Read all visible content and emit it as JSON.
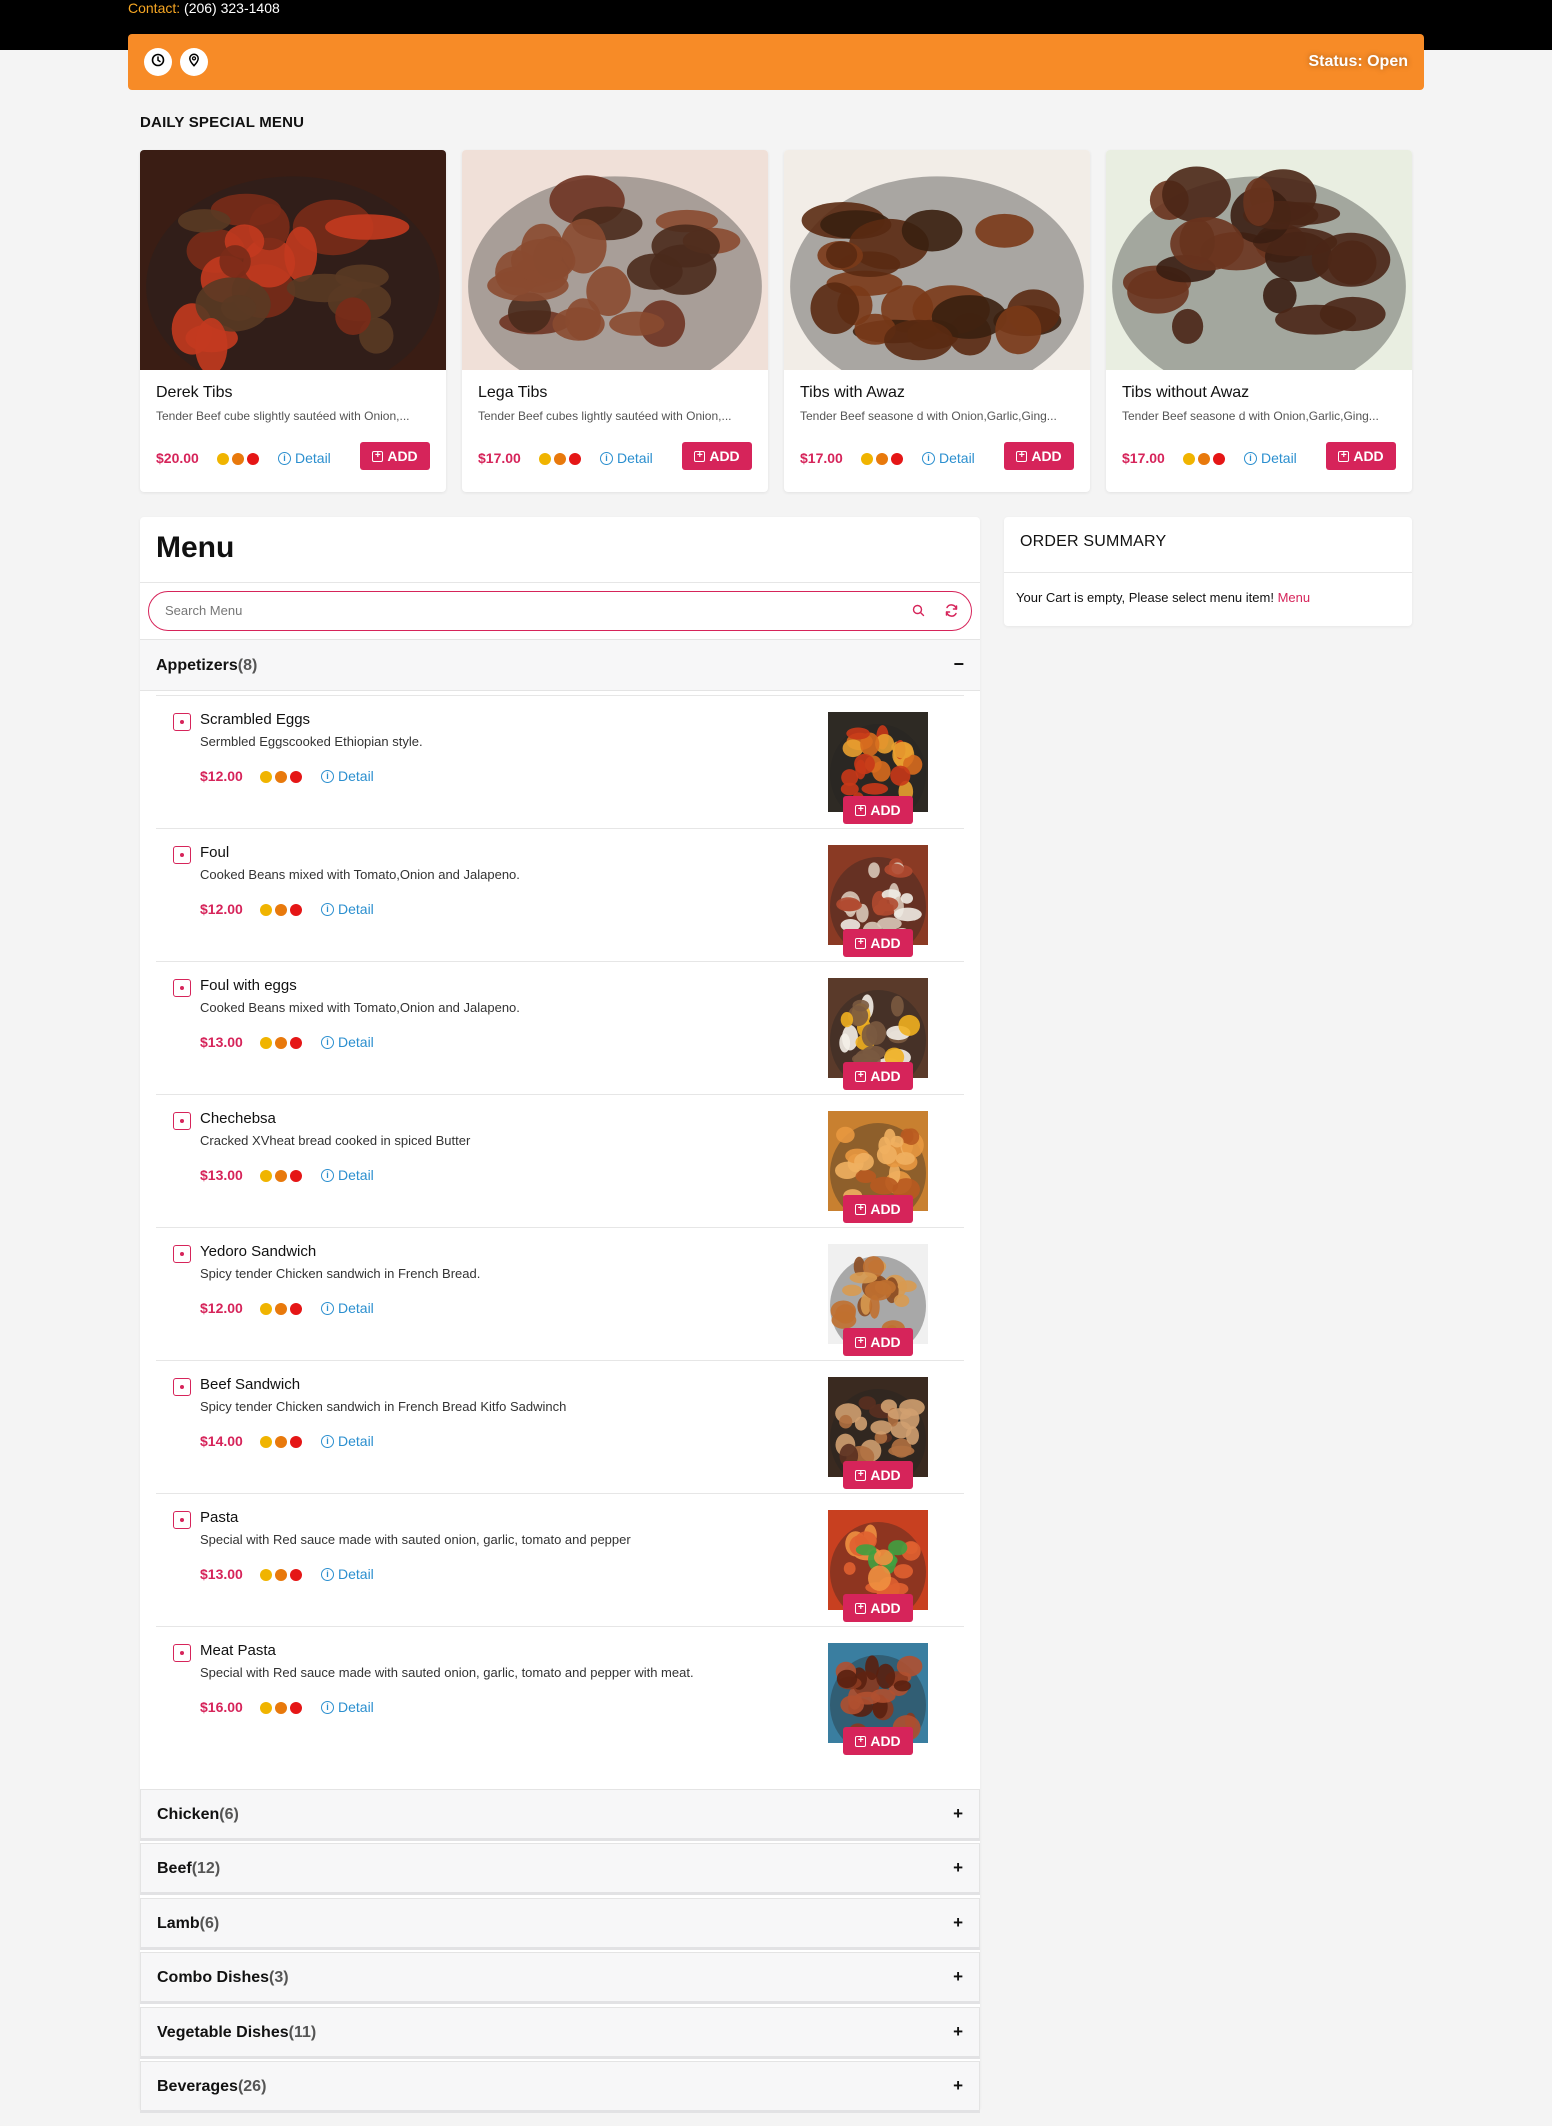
{
  "header": {
    "contact_label": "Contact:",
    "contact_phone": "(206) 323-1408",
    "status": "Status: Open",
    "clock_icon": "clock-icon",
    "location_icon": "map-pin-icon"
  },
  "specials": {
    "title": "DAILY SPECIAL MENU",
    "items": [
      {
        "name": "Derek Tibs",
        "desc": "Tender Beef cube slightly sautéed with Onion,...",
        "price": "$20.00",
        "detail": "Detail",
        "add": "ADD"
      },
      {
        "name": "Lega Tibs",
        "desc": "Tender Beef cubes lightly sautéed with Onion,...",
        "price": "$17.00",
        "detail": "Detail",
        "add": "ADD"
      },
      {
        "name": "Tibs with Awaz",
        "desc": "Tender Beef seasone d with Onion,Garlic,Ging...",
        "price": "$17.00",
        "detail": "Detail",
        "add": "ADD"
      },
      {
        "name": "Tibs without Awaz",
        "desc": "Tender Beef seasone d with Onion,Garlic,Ging...",
        "price": "$17.00",
        "detail": "Detail",
        "add": "ADD"
      }
    ]
  },
  "menu": {
    "title": "Menu",
    "search_placeholder": "Search Menu",
    "open_category": {
      "name": "Appetizers",
      "count": "(8)",
      "toggle": "−"
    },
    "items": [
      {
        "name": "Scrambled Eggs",
        "desc": "Sermbled Eggscooked Ethiopian style.",
        "price": "$12.00",
        "detail": "Detail",
        "add": "ADD"
      },
      {
        "name": "Foul",
        "desc": "Cooked Beans mixed with Tomato,Onion and Jalapeno.",
        "price": "$12.00",
        "detail": "Detail",
        "add": "ADD"
      },
      {
        "name": "Foul with eggs",
        "desc": "Cooked Beans mixed with Tomato,Onion and Jalapeno.",
        "price": "$13.00",
        "detail": "Detail",
        "add": "ADD"
      },
      {
        "name": "Chechebsa",
        "desc": "Cracked XVheat bread cooked in spiced Butter",
        "price": "$13.00",
        "detail": "Detail",
        "add": "ADD"
      },
      {
        "name": "Yedoro Sandwich",
        "desc": "Spicy tender Chicken sandwich in French Bread.",
        "price": "$12.00",
        "detail": "Detail",
        "add": "ADD"
      },
      {
        "name": "Beef Sandwich",
        "desc": "Spicy tender Chicken sandwich in French Bread Kitfo Sadwinch",
        "price": "$14.00",
        "detail": "Detail",
        "add": "ADD"
      },
      {
        "name": "Pasta",
        "desc": "Special with Red sauce made with sauted onion, garlic, tomato and pepper",
        "price": "$13.00",
        "detail": "Detail",
        "add": "ADD"
      },
      {
        "name": "Meat Pasta",
        "desc": "Special with Red sauce made with sauted onion, garlic, tomato and pepper with meat.",
        "price": "$16.00",
        "detail": "Detail",
        "add": "ADD"
      }
    ],
    "closed_categories": [
      {
        "name": "Chicken",
        "count": "(6)",
        "toggle": "+"
      },
      {
        "name": "Beef",
        "count": "(12)",
        "toggle": "+"
      },
      {
        "name": "Lamb",
        "count": "(6)",
        "toggle": "+"
      },
      {
        "name": "Combo Dishes",
        "count": "(3)",
        "toggle": "+"
      },
      {
        "name": "Vegetable Dishes",
        "count": "(11)",
        "toggle": "+"
      },
      {
        "name": "Beverages",
        "count": "(26)",
        "toggle": "+"
      }
    ]
  },
  "order": {
    "title": "ORDER SUMMARY",
    "empty_msg": "Your Cart is empty, Please select menu item!",
    "menu_link": "Menu"
  },
  "colors": {
    "accent": "#d6245a",
    "orange": "#f78b27",
    "link": "#2b8fcf",
    "spice_dots": [
      "#f0b400",
      "#e8790c",
      "#e51616"
    ]
  }
}
